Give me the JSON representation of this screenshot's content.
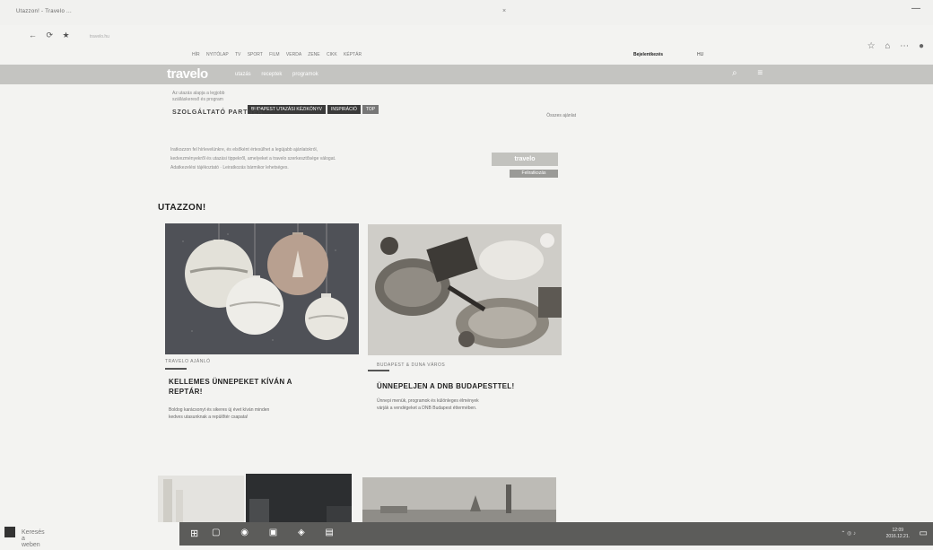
{
  "browser": {
    "tab_text": "Utazzon! - Travelo ...",
    "tab_close": "×",
    "window_min": "—",
    "nav_icons": "← ⟳ ★",
    "url_text": "travelo.hu",
    "right_icons": "☆ ⌂ ⋯ ●"
  },
  "top_nav": {
    "links": "HÍR  NYITÓLAP  TV  SPORT  FILM  VERDA  ZENE  CIKK  KÉPTÁR",
    "user": "Bejelentkezés",
    "flag": "HU"
  },
  "site_header": {
    "logo": "travelo",
    "menu": "utazás  receptek  programok",
    "icons": "⌕ ≡"
  },
  "strip": {
    "line1": "Az utazás alapja a legjobb",
    "line2": "szálláskereső és program",
    "tags": [
      "BUDAPEST UTAZÁSI KÉZIKÖNYV",
      "INSPIRÁCIÓ",
      "TOP"
    ],
    "section_head": "SZOLGÁLTATÓ PARTNER",
    "section_right": "Összes ajánlat"
  },
  "newsletter": {
    "lines": [
      "Iratkozzon fel hírlevelünkre, és elsőként értesülhet a legújabb ajánlatokról,",
      "kedvezményekről és utazási tippekről, amelyeket a travelo szerkesztősége válogat.",
      "Adatkezelési tájékoztató · Leiratkozás bármikor lehetséges."
    ],
    "button": "travelo",
    "button2": "Feliratkozás"
  },
  "section_title": "UTAZZON!",
  "cards": [
    {
      "tag": "TRAVELO AJÁNLÓ",
      "title_line1": "KELLEMES ÜNNEPEKET KÍVÁN A",
      "title_line2": "REPTÁR!",
      "desc_line1": "Boldog karácsonyt és sikeres új évet kíván minden",
      "desc_line2": "kedves utasunknak a repülőtér csapata!"
    },
    {
      "tag": "BUDAPEST & DUNA VÁROS",
      "title_line1": "ÜNNEPELJEN A DNB BUDAPESTTEL!",
      "desc_line1": "Ünnepi menük, programok és különleges élmények",
      "desc_line2": "várják a vendégeket a DNB Budapest éttermében."
    }
  ],
  "taskbar": {
    "start": "⊞",
    "icons": "▢ ◉ ▣ ◈ ▤",
    "tray": "⌃ ◎ ♪",
    "clock_time": "12:09",
    "clock_date": "2016.12.21.",
    "notif": "▭"
  },
  "os_search": "Keresés a weben"
}
